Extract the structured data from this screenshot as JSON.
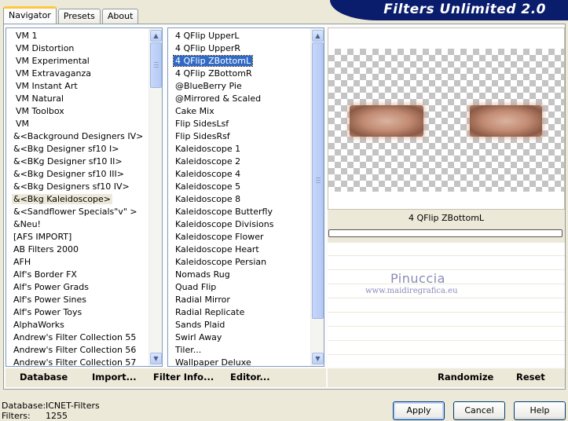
{
  "window": {
    "title": "Filters Unlimited 2.0"
  },
  "tabs": [
    {
      "label": "Navigator",
      "active": true
    },
    {
      "label": "Presets",
      "active": false
    },
    {
      "label": "About",
      "active": false
    }
  ],
  "categories": {
    "items": [
      "VM 1",
      "VM Distortion",
      "VM Experimental",
      "VM Extravaganza",
      "VM Instant Art",
      "VM Natural",
      "VM Toolbox",
      "VM",
      "&<Background Designers IV>",
      "&<Bkg Designer sf10 I>",
      "&<BKg Designer sf10 II>",
      "&<Bkg Designer sf10 III>",
      "&<Bkg Designers sf10 IV>",
      "&<Bkg Kaleidoscope>",
      "&<Sandflower Specials\"v\" >",
      "&Neu!",
      "[AFS IMPORT]",
      "AB Filters 2000",
      "AFH",
      "Alf's Border FX",
      "Alf's Power Grads",
      "Alf's Power Sines",
      "Alf's Power Toys",
      "AlphaWorks",
      "Andrew's Filter Collection 55",
      "Andrew's Filter Collection 56",
      "Andrew's Filter Collection 57"
    ],
    "selected_index": 13
  },
  "filters": {
    "items": [
      "4 QFlip UpperL",
      "4 QFlip UpperR",
      "4 QFlip ZBottomL",
      "4 QFlip ZBottomR",
      "@BlueBerry Pie",
      "@Mirrored & Scaled",
      "Cake Mix",
      "Flip SidesLsf",
      "Flip SidesRsf",
      "Kaleidoscope 1",
      "Kaleidoscope 2",
      "Kaleidoscope 4",
      "Kaleidoscope 5",
      "Kaleidoscope 8",
      "Kaleidoscope Butterfly",
      "Kaleidoscope Divisions",
      "Kaleidoscope Flower",
      "Kaleidoscope Heart",
      "Kaleidoscope Persian",
      "Nomads Rug",
      "Quad Flip",
      "Radial Mirror",
      "Radial Replicate",
      "Sands Plaid",
      "Swirl Away",
      "Tiler...",
      "Wallpaper Deluxe"
    ],
    "selected_index": 2
  },
  "left_links": {
    "database": "Database",
    "import": "Import...",
    "filter_info": "Filter Info...",
    "editor": "Editor..."
  },
  "right_links": {
    "randomize": "Randomize",
    "reset": "Reset"
  },
  "preview": {
    "filter_name": "4 QFlip ZBottomL",
    "watermark": "Pinuccia",
    "watermark_url": "www.maidiregrafica.eu"
  },
  "footer": {
    "database_label": "Database:",
    "database_value": "ICNET-Filters",
    "filters_label": "Filters:",
    "filters_value": "1255"
  },
  "buttons": {
    "apply": "Apply",
    "cancel": "Cancel",
    "help": "Help"
  },
  "colors": {
    "banner": "#0a1c6c",
    "selection": "#316ac5",
    "face": "#ece9d8"
  }
}
